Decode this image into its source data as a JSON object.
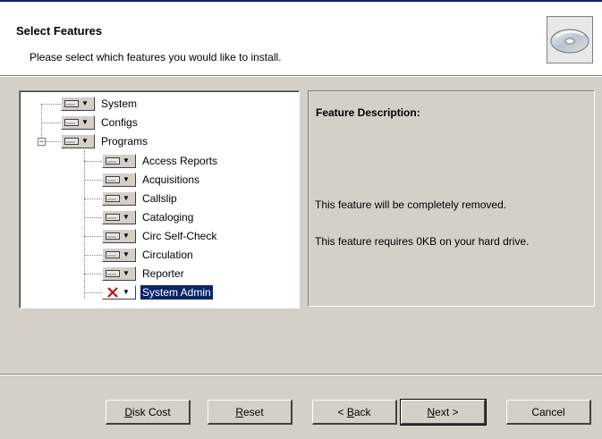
{
  "header": {
    "title": "Select Features",
    "subtitle": "Please select which features you would like to install."
  },
  "tree": {
    "items": [
      {
        "label": "System",
        "state": "installed",
        "level": 0
      },
      {
        "label": "Configs",
        "state": "installed",
        "level": 0
      },
      {
        "label": "Programs",
        "state": "installed",
        "level": 0,
        "expanded": true
      },
      {
        "label": "Access Reports",
        "state": "installed",
        "level": 1
      },
      {
        "label": "Acquisitions",
        "state": "installed",
        "level": 1
      },
      {
        "label": "Callslip",
        "state": "installed",
        "level": 1
      },
      {
        "label": "Cataloging",
        "state": "installed",
        "level": 1
      },
      {
        "label": "Circ Self-Check",
        "state": "installed",
        "level": 1
      },
      {
        "label": "Circulation",
        "state": "installed",
        "level": 1
      },
      {
        "label": "Reporter",
        "state": "installed",
        "level": 1
      },
      {
        "label": "System Admin",
        "state": "removed",
        "level": 1,
        "selected": true
      }
    ]
  },
  "description": {
    "title": "Feature Description:",
    "line1": "This feature will be completely removed.",
    "line2": "This feature requires 0KB on your hard drive."
  },
  "buttons": {
    "disk_cost_u": "D",
    "disk_cost_rest": "isk Cost",
    "reset_u": "R",
    "reset_rest": "eset",
    "back_pre": "< ",
    "back_u": "B",
    "back_rest": "ack",
    "next_u": "N",
    "next_rest": "ext >",
    "cancel": "Cancel"
  },
  "colors": {
    "dialog_bg": "#d4d0c8",
    "selection": "#0a246a",
    "remove_x": "#c00000"
  }
}
